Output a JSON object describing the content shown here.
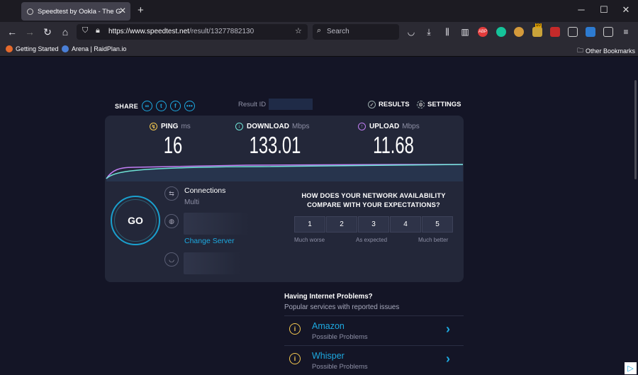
{
  "browser": {
    "tab_title": "Speedtest by Ookla - The Global",
    "new_tab": "+",
    "window_min": "─",
    "window_max": "☐",
    "window_close": "✕",
    "url_host": "https://www.speedtest.net",
    "url_path": "/result/13277882130",
    "search_placeholder": "Search",
    "bookmarks": [
      {
        "label": "Getting Started"
      },
      {
        "label": "Arena | RaidPlan.io"
      }
    ],
    "other_bookmarks": "Other Bookmarks",
    "extension_badge": "10",
    "colors": {
      "abp": "#e23b3b",
      "grammarly": "#15c39a",
      "accent": "#1da9e0"
    }
  },
  "speedtest": {
    "share_label": "SHARE",
    "result_id_label": "Result ID",
    "results_label": "RESULTS",
    "settings_label": "SETTINGS",
    "ping": {
      "label": "PING",
      "unit": "ms",
      "value": "16"
    },
    "download": {
      "label": "DOWNLOAD",
      "unit": "Mbps",
      "value": "133.01"
    },
    "upload": {
      "label": "UPLOAD",
      "unit": "Mbps",
      "value": "11.68"
    },
    "go_label": "GO",
    "connections_label": "Connections",
    "connections_value": "Multi",
    "change_server": "Change Server",
    "question": "HOW DOES YOUR NETWORK AVAILABILITY COMPARE WITH YOUR EXPECTATIONS?",
    "ratings": [
      "1",
      "2",
      "3",
      "4",
      "5"
    ],
    "rating_labels": [
      "Much worse",
      "As expected",
      "Much better"
    ]
  },
  "problems": {
    "title": "Having Internet Problems?",
    "subtitle": "Popular services with reported issues",
    "services": [
      {
        "name": "Amazon",
        "status": "Possible Problems"
      },
      {
        "name": "Whisper",
        "status": "Possible Problems"
      }
    ]
  }
}
